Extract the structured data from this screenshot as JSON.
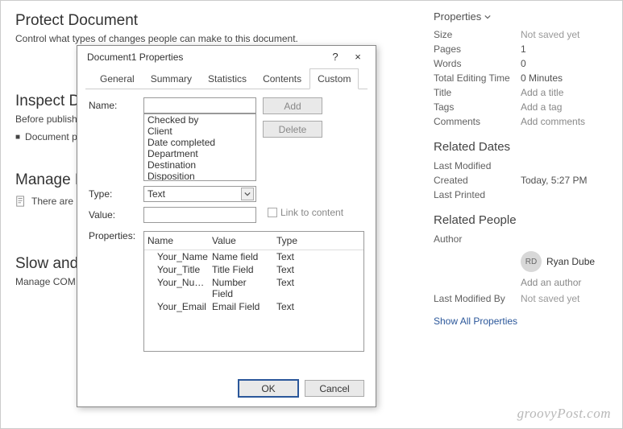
{
  "bg": {
    "protect_title": "Protect Document",
    "protect_sub": "Control what types of changes people can make to this document.",
    "inspect_title": "Inspect Do",
    "inspect_sub": "Before publishin",
    "inspect_item": "Document p",
    "manage_title": "Manage D",
    "manage_sub": "There are n",
    "slow_title": "Slow and D",
    "slow_sub": "Manage COM ad"
  },
  "panel": {
    "properties_heading": "Properties",
    "size_k": "Size",
    "size_v": "Not saved yet",
    "pages_k": "Pages",
    "pages_v": "1",
    "words_k": "Words",
    "words_v": "0",
    "tet_k": "Total Editing Time",
    "tet_v": "0 Minutes",
    "title_k": "Title",
    "title_v": "Add a title",
    "tags_k": "Tags",
    "tags_v": "Add a tag",
    "comments_k": "Comments",
    "comments_v": "Add comments",
    "related_dates": "Related Dates",
    "lm_k": "Last Modified",
    "lm_v": "",
    "created_k": "Created",
    "created_v": "Today, 5:27 PM",
    "lp_k": "Last Printed",
    "lp_v": "",
    "related_people": "Related People",
    "author_k": "Author",
    "author_initials": "RD",
    "author_name": "Ryan Dube",
    "add_author": "Add an author",
    "lmb_k": "Last Modified By",
    "lmb_v": "Not saved yet",
    "show_all": "Show All Properties"
  },
  "dialog": {
    "title": "Document1 Properties",
    "help": "?",
    "close": "×",
    "tabs": [
      "General",
      "Summary",
      "Statistics",
      "Contents",
      "Custom"
    ],
    "active_tab": "Custom",
    "name_label": "Name:",
    "name_value": "",
    "type_label": "Type:",
    "type_value": "Text",
    "value_label": "Value:",
    "value_value": "",
    "link_to_content": "Link to content",
    "properties_label": "Properties:",
    "add_btn": "Add",
    "delete_btn": "Delete",
    "ok_btn": "OK",
    "cancel_btn": "Cancel",
    "name_options": [
      "Checked by",
      "Client",
      "Date completed",
      "Department",
      "Destination",
      "Disposition"
    ],
    "table_headers": {
      "name": "Name",
      "value": "Value",
      "type": "Type"
    },
    "table_rows": [
      {
        "name": "Your_Name",
        "value": "Name field",
        "type": "Text"
      },
      {
        "name": "Your_Title",
        "value": "Title Field",
        "type": "Text"
      },
      {
        "name": "Your_Nu…",
        "value": "Number Field",
        "type": "Text"
      },
      {
        "name": "Your_Email",
        "value": "Email Field",
        "type": "Text"
      }
    ]
  },
  "watermark": "groovyPost.com"
}
